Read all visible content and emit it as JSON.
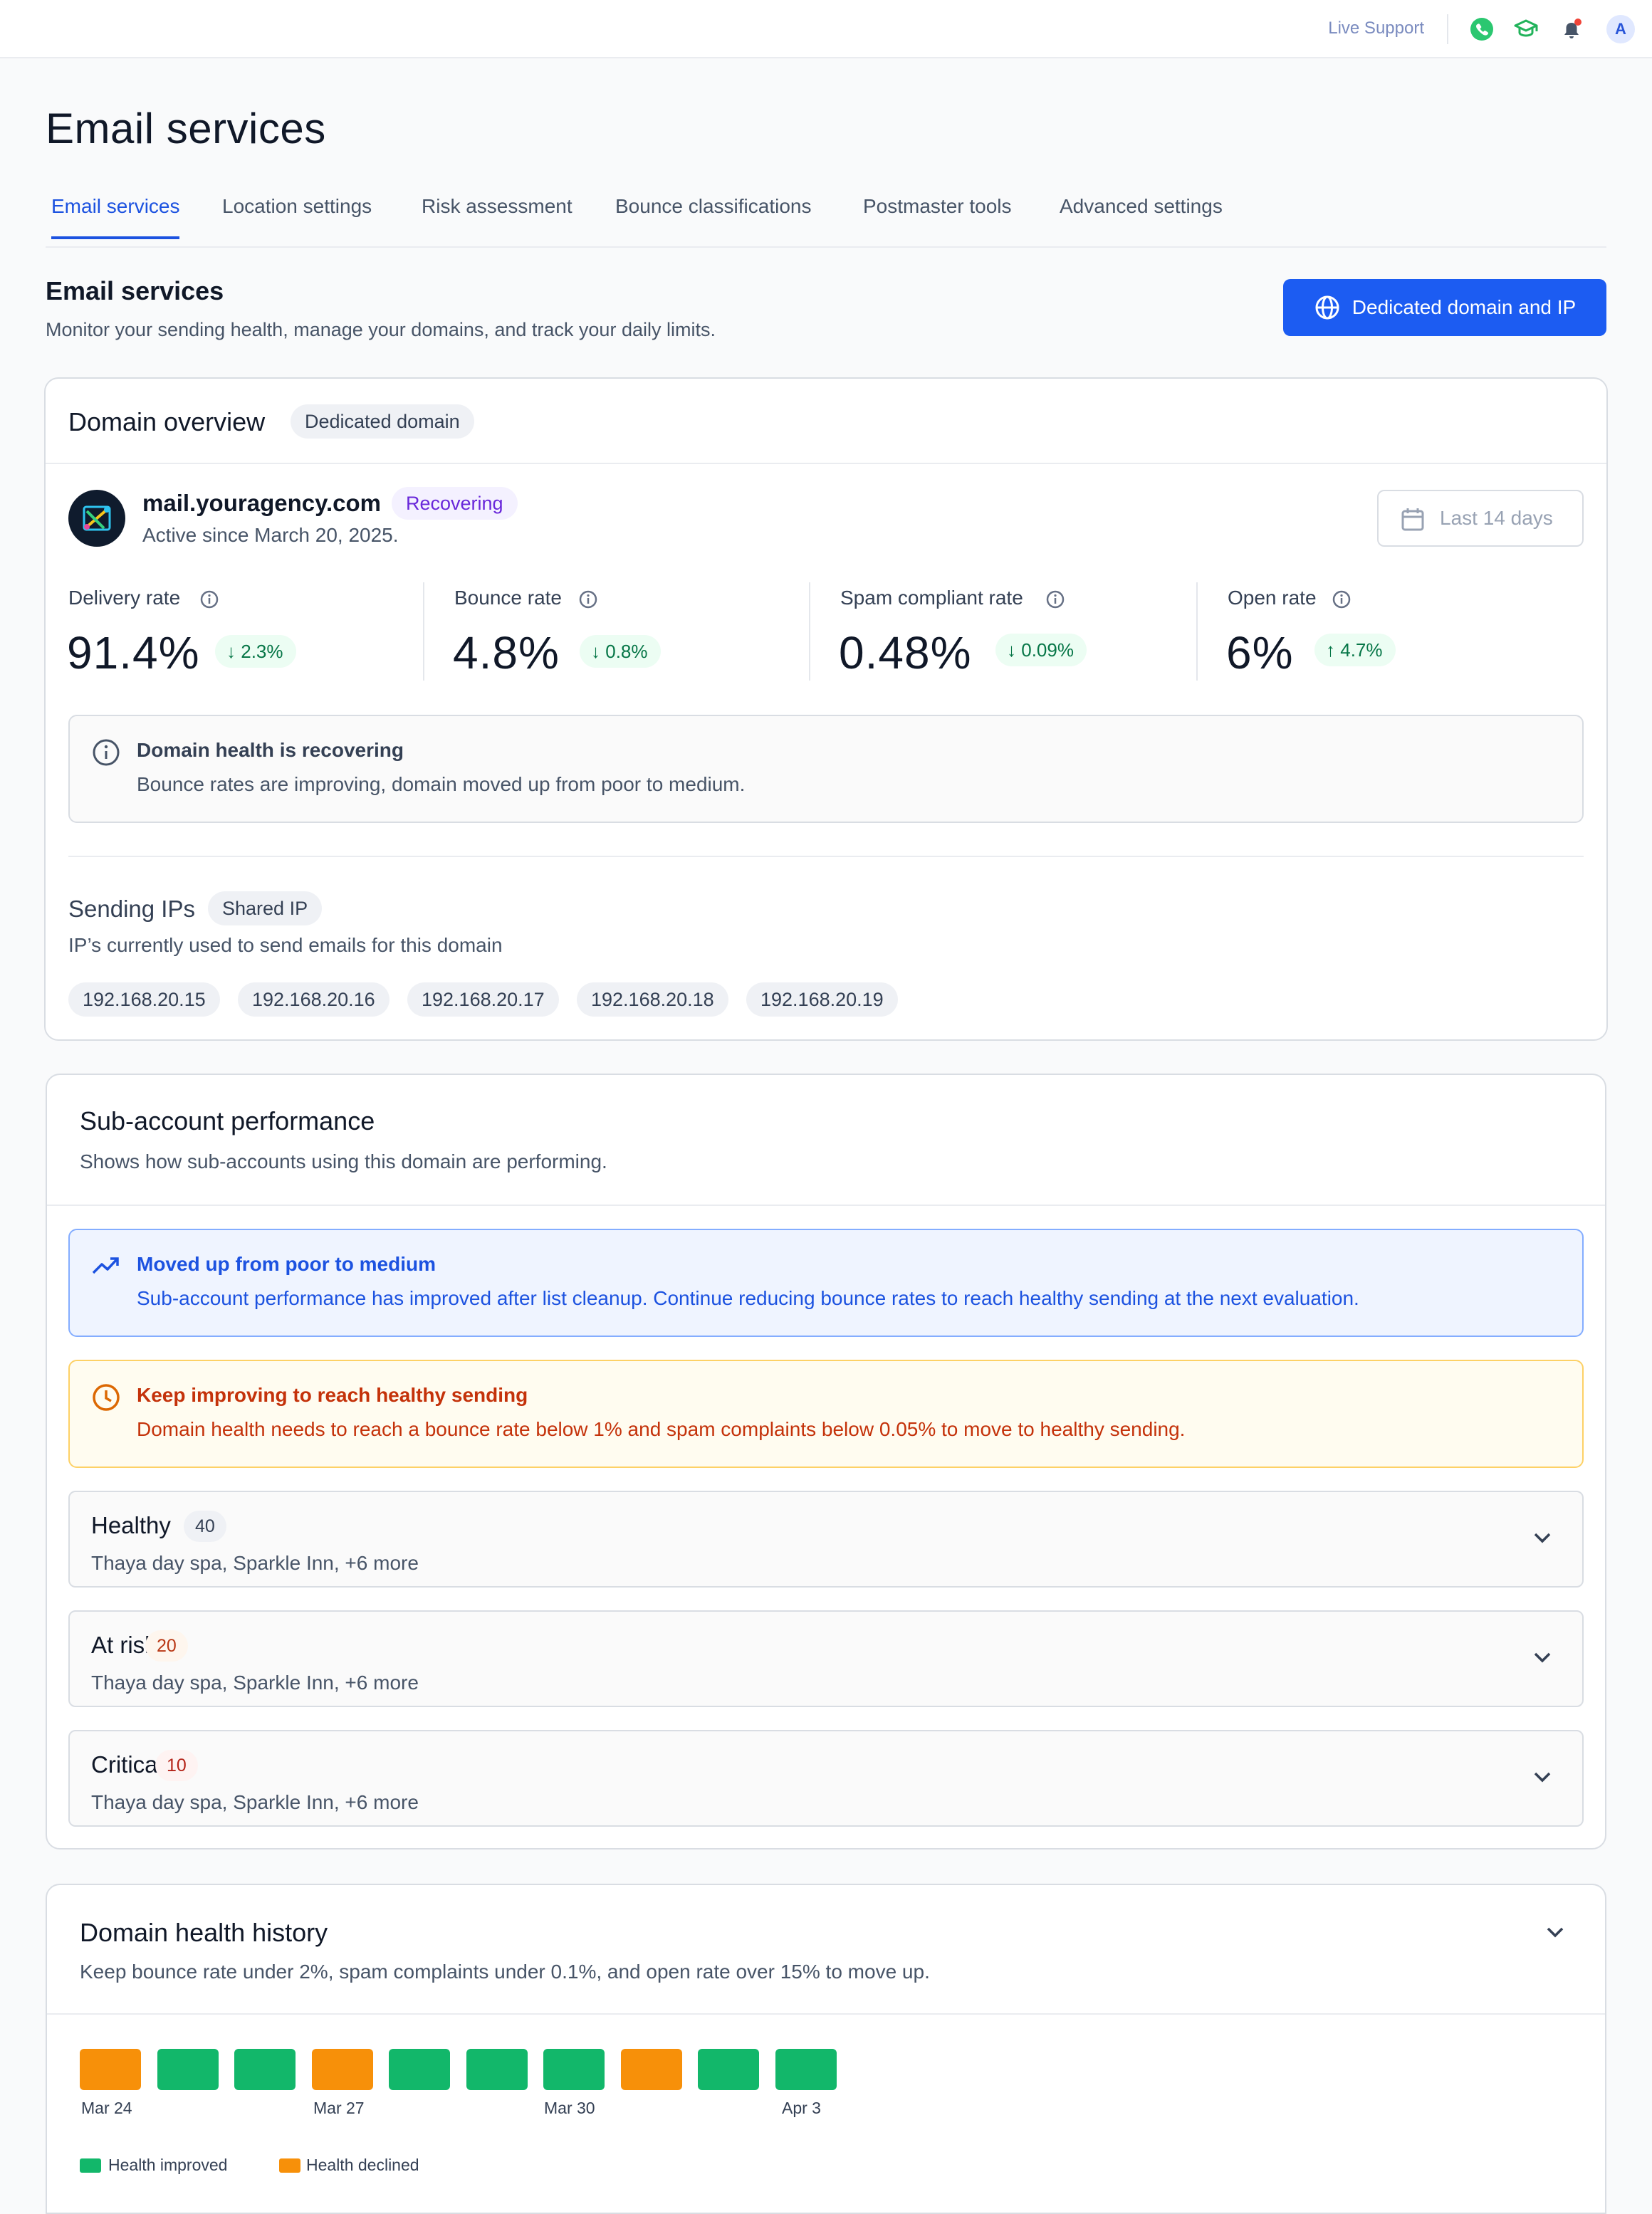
{
  "topbar": {
    "live_support": "Live Support",
    "avatar_letter": "A"
  },
  "page": {
    "title": "Email services"
  },
  "tabs": [
    {
      "label": "Email services",
      "active": true
    },
    {
      "label": "Location settings"
    },
    {
      "label": "Risk assessment"
    },
    {
      "label": "Bounce classifications"
    },
    {
      "label": "Postmaster tools"
    },
    {
      "label": "Advanced settings"
    }
  ],
  "section": {
    "title": "Email services",
    "subtitle": "Monitor your sending health, manage your domains, and track your daily limits.",
    "cta_label": "Dedicated domain and IP"
  },
  "domain_overview": {
    "title": "Domain overview",
    "badge": "Dedicated domain",
    "domain_name": "mail.youragency.com",
    "status": "Recovering",
    "active_since": "Active since March 20, 2025.",
    "date_range": "Last 14 days",
    "metrics": [
      {
        "label": "Delivery rate",
        "value": "91.4%",
        "delta": "2.3%",
        "direction": "down"
      },
      {
        "label": "Bounce rate",
        "value": "4.8%",
        "delta": "0.8%",
        "direction": "down"
      },
      {
        "label": "Spam compliant rate",
        "value": "0.48%",
        "delta": "0.09%",
        "direction": "down"
      },
      {
        "label": "Open rate",
        "value": "6%",
        "delta": "4.7%",
        "direction": "up"
      }
    ],
    "health_notice": {
      "title": "Domain health is recovering",
      "body": "Bounce rates are improving, domain moved up from poor to medium."
    },
    "sending_ips": {
      "title": "Sending IPs",
      "badge": "Shared IP",
      "subtitle": "IP’s currently used to send emails for this domain",
      "ips": [
        "192.168.20.15",
        "192.168.20.16",
        "192.168.20.17",
        "192.168.20.18",
        "192.168.20.19"
      ]
    }
  },
  "subaccount": {
    "title": "Sub-account performance",
    "subtitle": "Shows how sub-accounts using this domain are performing.",
    "info_callout": {
      "title": "Moved up from poor to medium",
      "body": "Sub-account performance has improved after list cleanup. Continue reducing bounce rates to reach healthy sending at the next evaluation."
    },
    "warning_callout": {
      "title": "Keep improving to reach healthy sending",
      "body": "Domain health needs to reach a bounce rate below 1% and spam complaints below 0.05% to move to healthy sending."
    },
    "groups": [
      {
        "label": "Healthy",
        "count": "40",
        "members": "Thaya day spa, Sparkle Inn, +6 more"
      },
      {
        "label": "At risk",
        "count": "20",
        "members": "Thaya day spa, Sparkle Inn, +6 more"
      },
      {
        "label": "Critical",
        "count": "10",
        "members": "Thaya day spa, Sparkle Inn, +6 more"
      }
    ]
  },
  "history": {
    "title": "Domain health history",
    "subtitle": "Keep bounce rate under 2%, spam complaints under 0.1%, and open rate over 15% to move up.",
    "days": [
      "declined",
      "improved",
      "improved",
      "declined",
      "improved",
      "improved",
      "improved",
      "declined",
      "improved",
      "improved"
    ],
    "date_labels": [
      "Mar 24",
      "Mar 27",
      "Mar 30",
      "Apr 3"
    ],
    "legend": {
      "improved": "Health improved",
      "declined": "Health declined"
    },
    "colors": {
      "improved": "#12b76a",
      "declined": "#f79009"
    }
  }
}
